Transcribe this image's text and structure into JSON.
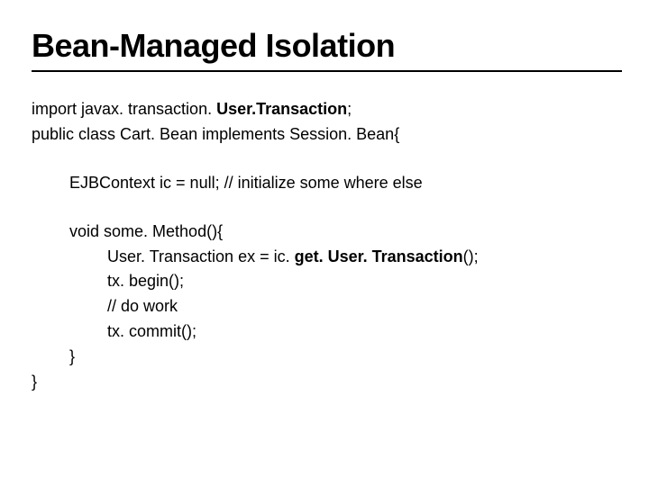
{
  "title": "Bean-Managed Isolation",
  "code": {
    "line1_pre": "import javax. transaction. ",
    "line1_bold": "User.Transaction",
    "line1_post": ";",
    "line2": "public class Cart. Bean implements Session. Bean{",
    "line3": "EJBContext ic = null; // initialize some where else",
    "line4": "void some. Method(){",
    "line5_pre": "User. Transaction ex = ic. ",
    "line5_bold": "get. User. Transaction",
    "line5_post": "();",
    "line6": "tx. begin();",
    "line7": "// do work",
    "line8": "tx. commit();",
    "line9": "}",
    "line10": "}"
  }
}
